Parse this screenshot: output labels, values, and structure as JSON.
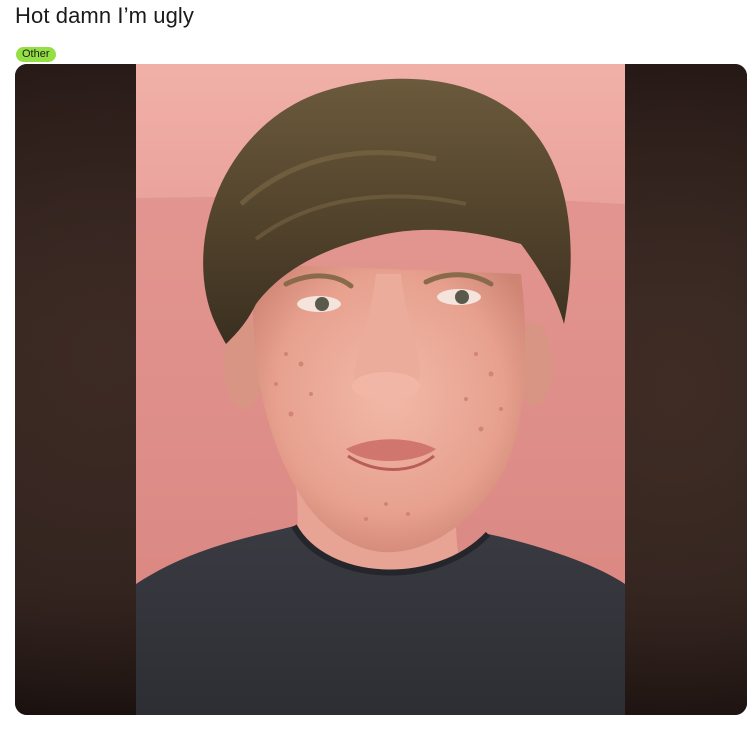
{
  "post": {
    "title": "Hot damn I’m ugly",
    "flair": {
      "label": "Other",
      "color": "#94e044"
    },
    "media": {
      "type": "image"
    }
  }
}
